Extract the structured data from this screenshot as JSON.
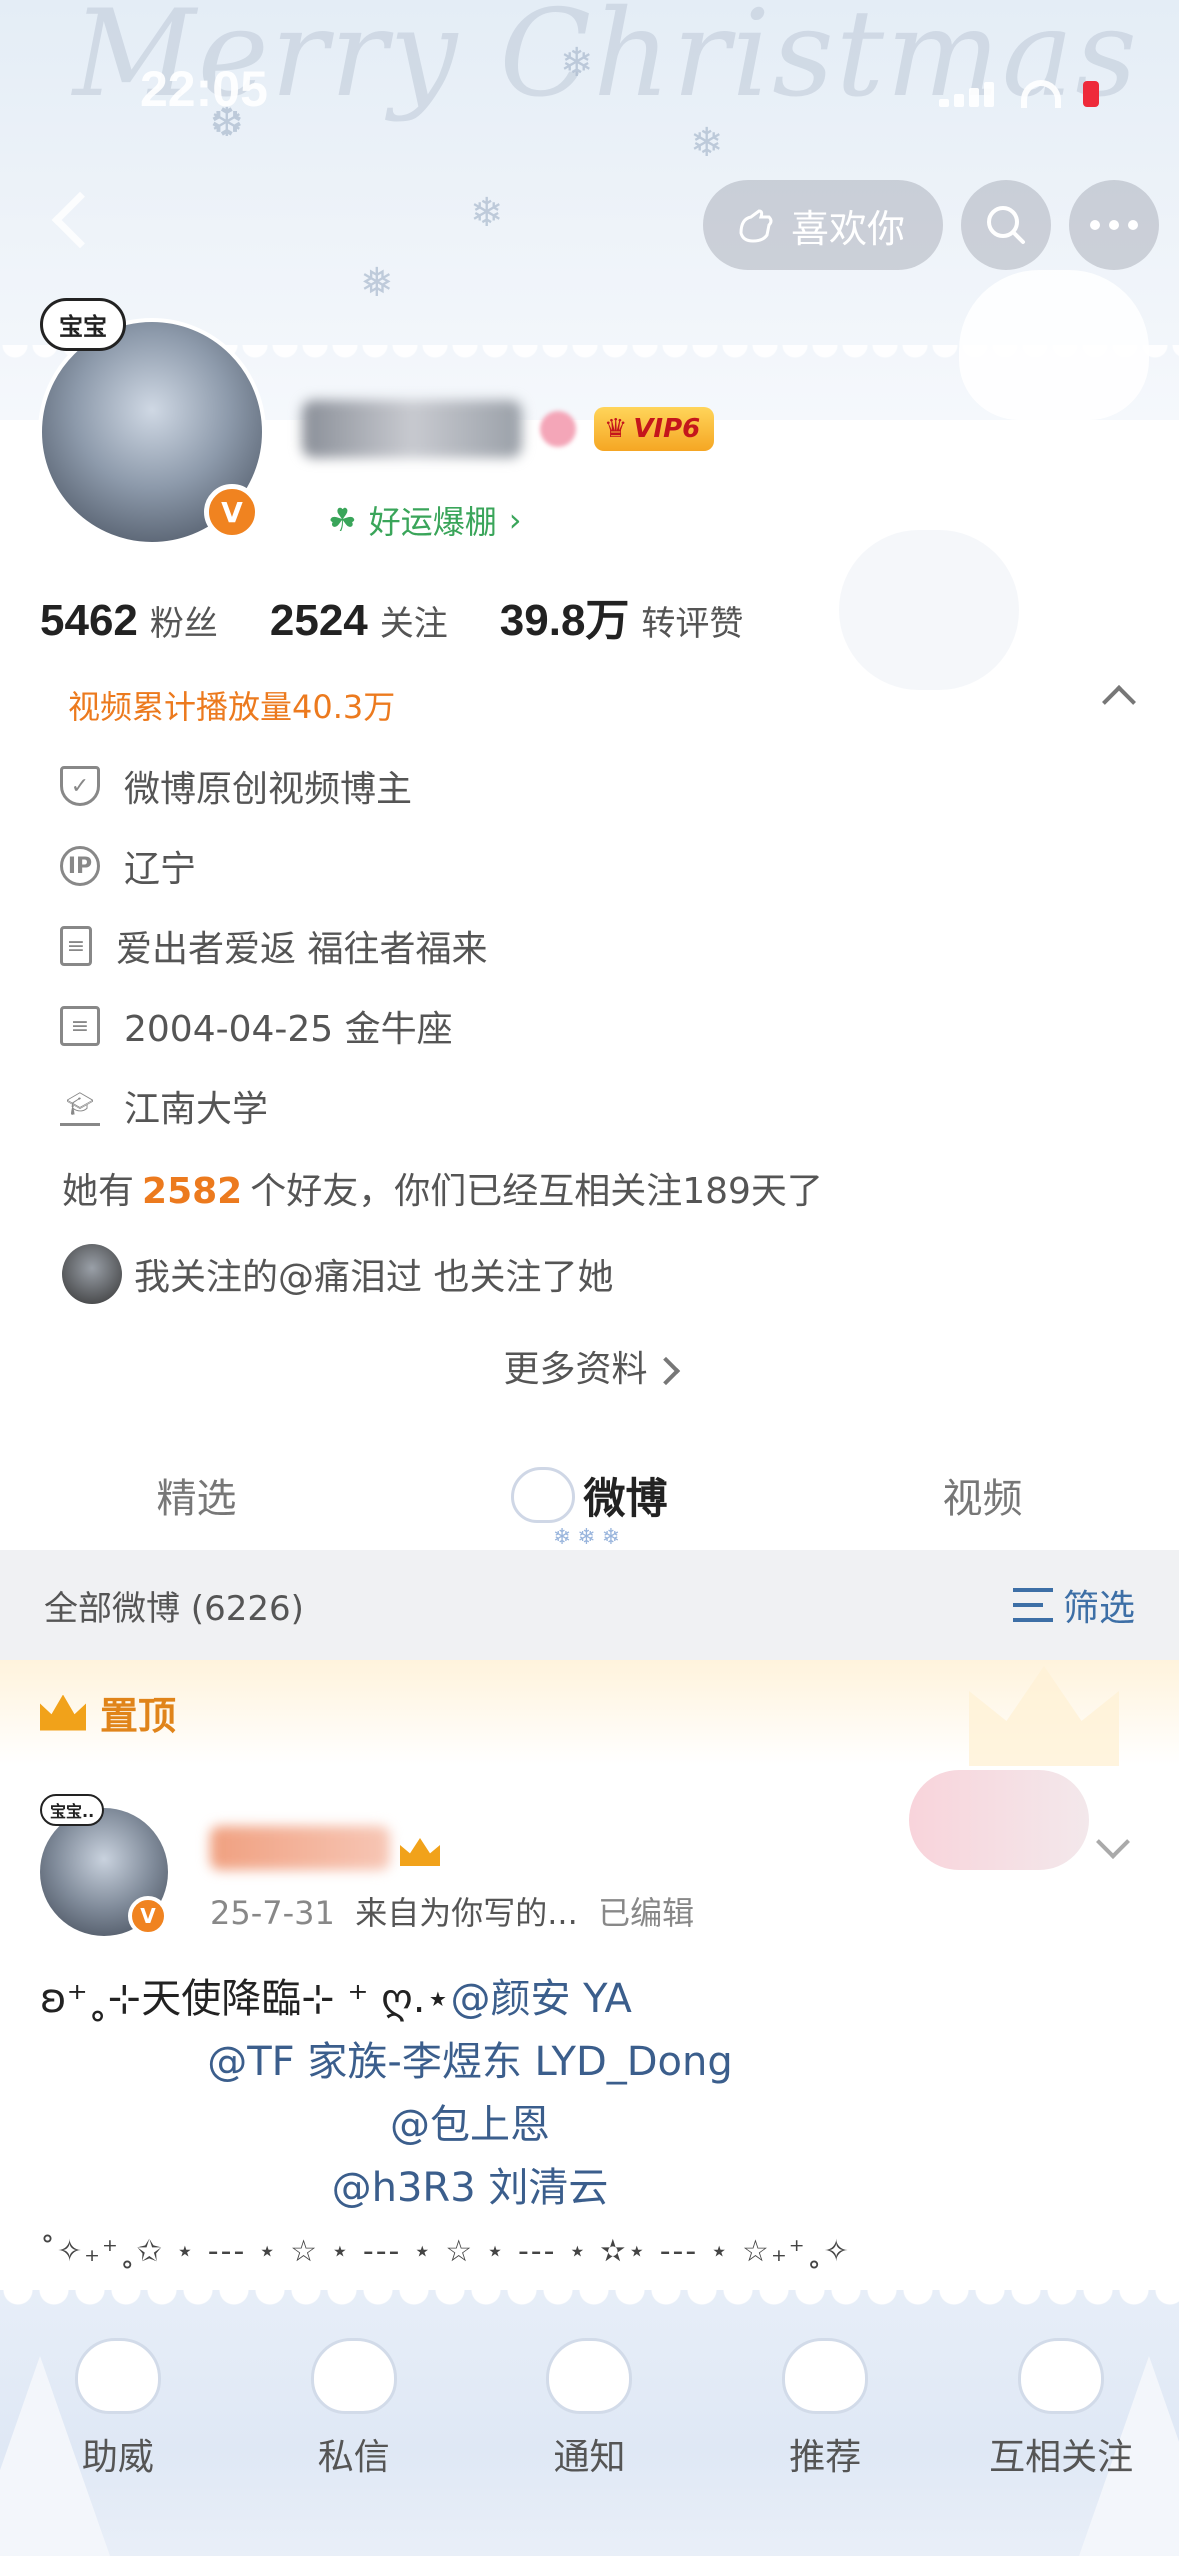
{
  "status_bar": {
    "time": "22:05"
  },
  "header": {
    "like_button_label": "喜欢你",
    "search_icon": "search-icon",
    "more_icon": "more-icon",
    "banner_text": "Merry Christmas"
  },
  "profile": {
    "avatar_bubble": "宝宝",
    "verified_badge": "V",
    "vip_label": "VIP6",
    "luck_label": "好运爆棚",
    "stats": [
      {
        "value": "5462",
        "label": "粉丝"
      },
      {
        "value": "2524",
        "label": "关注"
      },
      {
        "value": "39.8万",
        "label": "转评赞"
      }
    ]
  },
  "info": {
    "video_total": "视频累计播放量40.3万",
    "items": [
      {
        "icon": "shield-icon",
        "text": "微博原创视频博主"
      },
      {
        "icon": "ip-icon",
        "text": "辽宁"
      },
      {
        "icon": "document-icon",
        "text": "爱出者爱返 福往者福来"
      },
      {
        "icon": "calendar-icon",
        "text": "2004-04-25 金牛座"
      },
      {
        "icon": "graduation-cap-icon",
        "text": "江南大学"
      }
    ],
    "friends_prefix": "她有",
    "friends_count": "2582",
    "friends_suffix": "个好友，你们已经互相关注189天了",
    "mutual_text": "我关注的@痛泪过 也关注了她",
    "more_info": "更多资料"
  },
  "tabs": [
    {
      "label": "精选",
      "active": false
    },
    {
      "label": "微博",
      "active": true
    },
    {
      "label": "视频",
      "active": false
    }
  ],
  "feed": {
    "count_label": "全部微博 (6226)",
    "filter_label": "筛选",
    "pinned_label": "置顶"
  },
  "post": {
    "avatar_bubble": "宝宝..",
    "meta_date": "25-7-31",
    "meta_source": "来自为你写的...",
    "meta_edited": "已编辑",
    "line1_prefix": "ʚ⁺˳⊹天使降臨⊹ ⁺ ღ.⋆",
    "line1_mention": "@颜安 YA",
    "line2_mention": "@TF 家族-李煜东 LYD_Dong",
    "line3_mention": "@包上恩",
    "line4_mention": "@h3R3 刘清云",
    "stars_line": "˚✧₊⁺˳✩ ⋆ --- ⋆ ☆ ⋆ --- ⋆ ☆ ⋆ --- ⋆ ✫⋆ --- ⋆ ☆₊⁺˳✧"
  },
  "bottom_nav": [
    {
      "label": "助威"
    },
    {
      "label": "私信"
    },
    {
      "label": "通知"
    },
    {
      "label": "推荐"
    },
    {
      "label": "互相关注"
    }
  ],
  "colors": {
    "accent_orange": "#ec7a1e",
    "link_blue": "#3b5e8c",
    "luck_green": "#3aa55a",
    "verified_orange": "#f08320"
  }
}
